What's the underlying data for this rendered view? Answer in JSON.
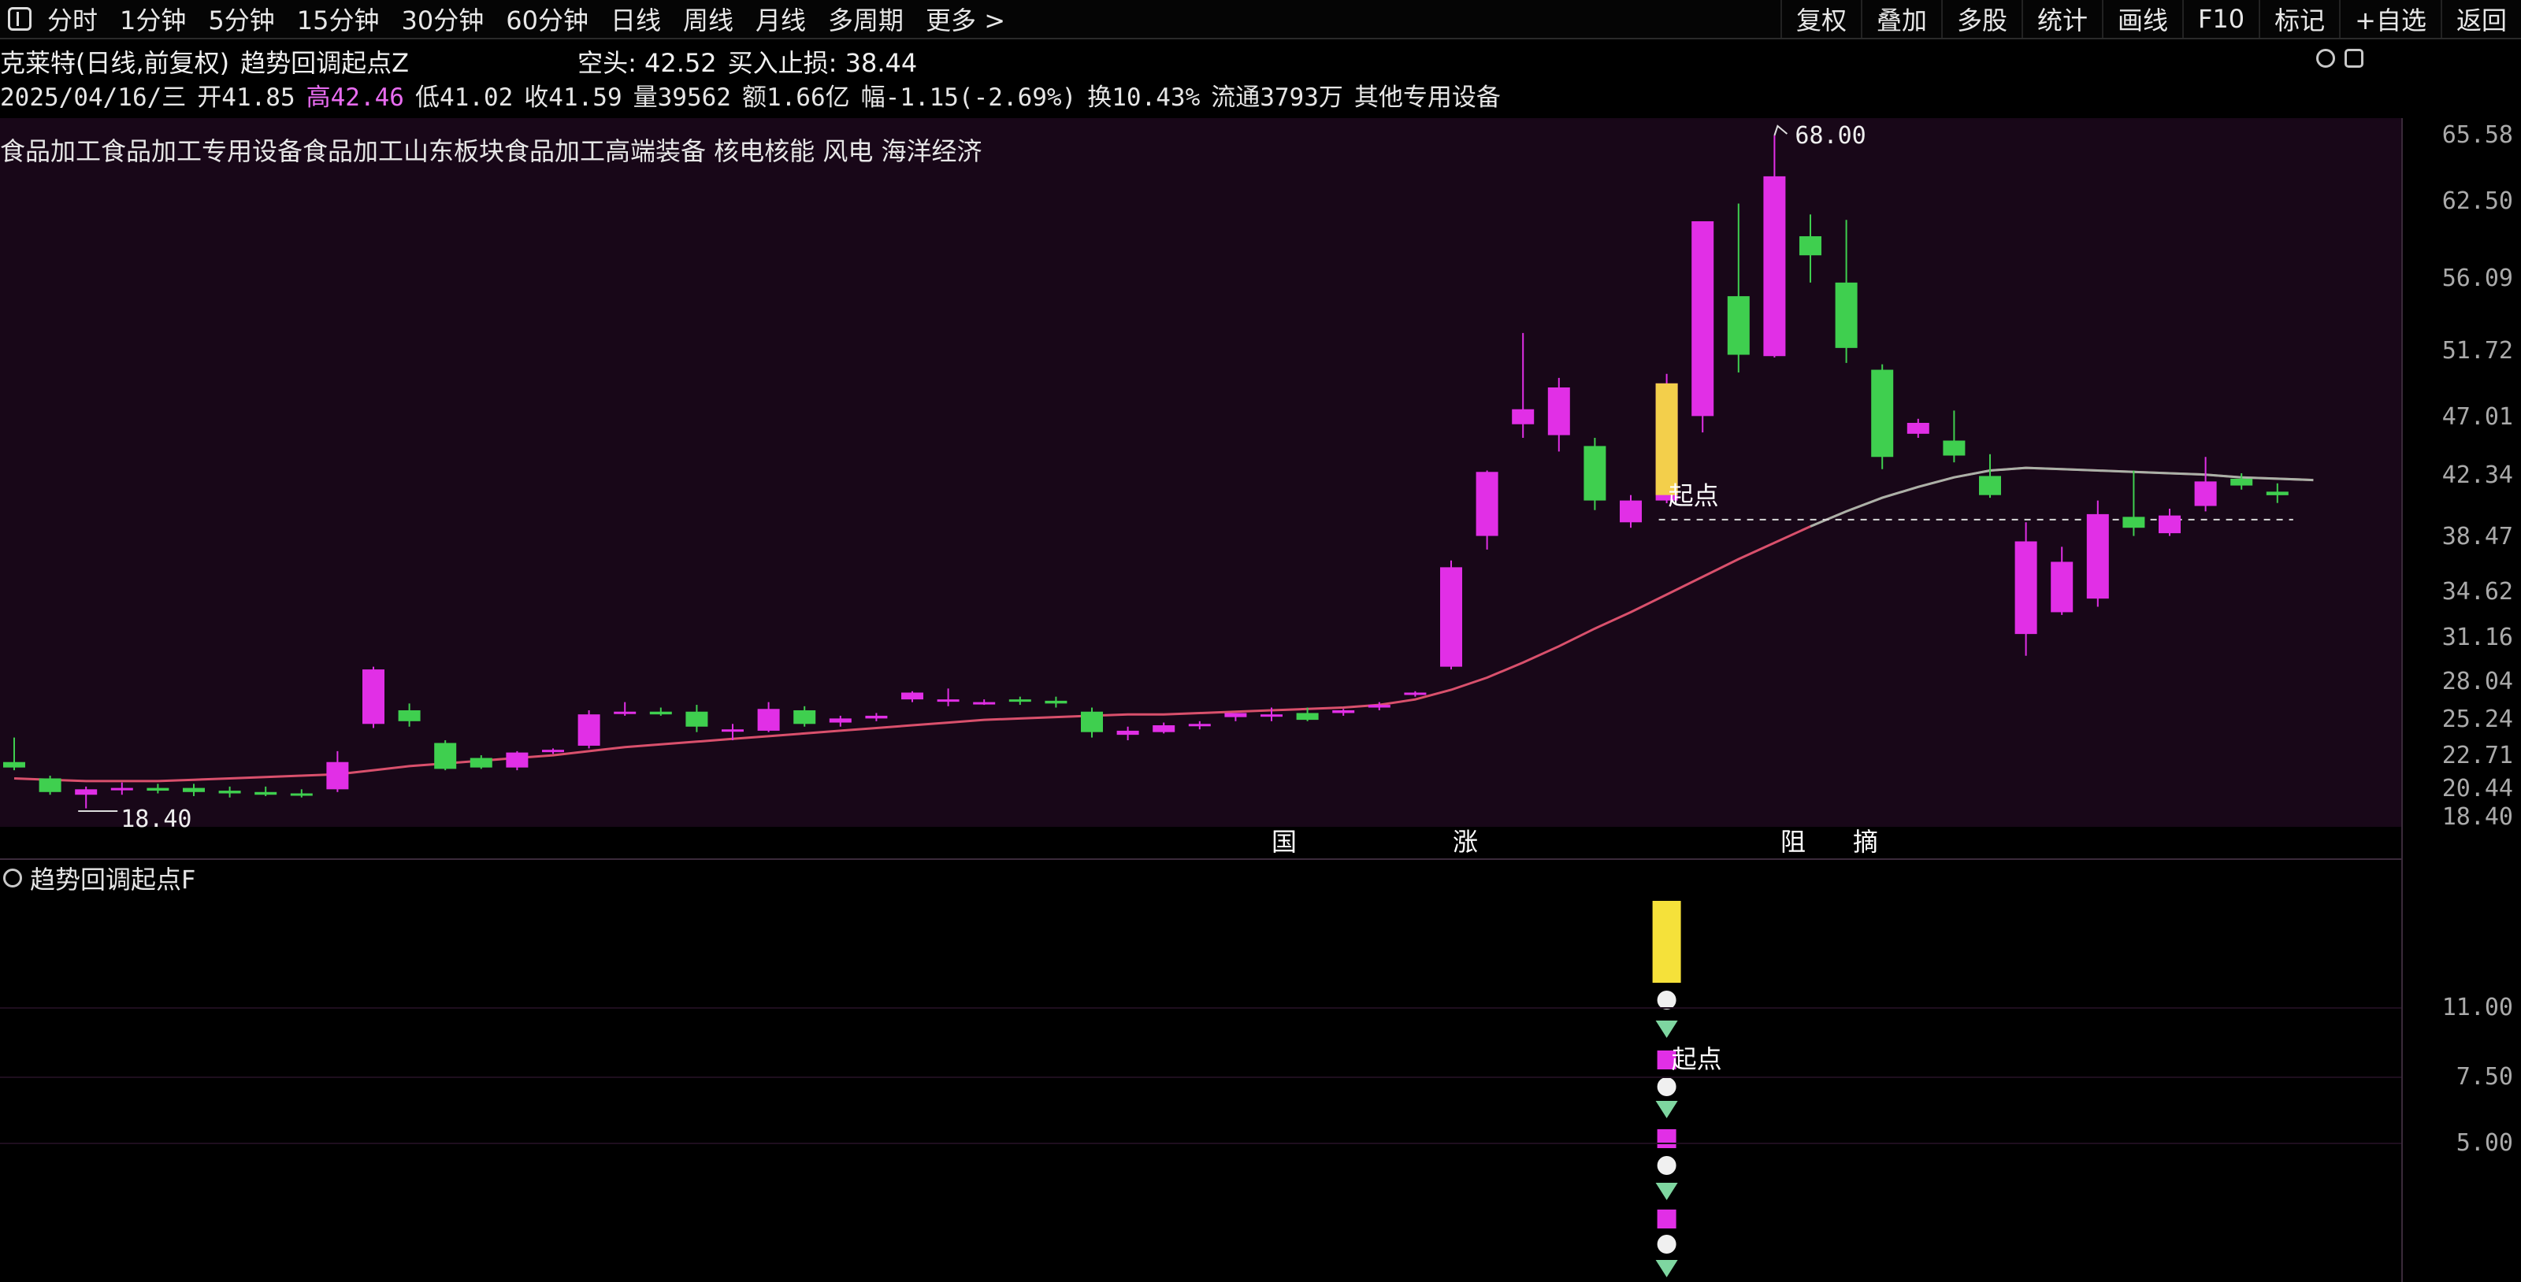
{
  "toolbar": {
    "left": [
      "分时",
      "1分钟",
      "5分钟",
      "15分钟",
      "30分钟",
      "60分钟",
      "日线",
      "周线",
      "月线",
      "多周期",
      "更多 >"
    ],
    "right": [
      "复权",
      "叠加",
      "多股",
      "统计",
      "画线",
      "F10",
      "标记",
      "+自选",
      "返回"
    ]
  },
  "info": {
    "stock": "克莱特(日线,前复权)",
    "indicator": "趋势回调起点Z",
    "short_label": "空头: 42.52",
    "stop_label": "买入止损: 38.44",
    "date": "2025/04/16/三",
    "open": "开41.85",
    "high": "高42.46",
    "low": "低41.02",
    "close": "收41.59",
    "volume": "量39562",
    "amount": "额1.66亿",
    "change": "幅-1.15(-2.69%)",
    "turnover": "换10.43%",
    "float": "流通3793万",
    "industry": "其他专用设备",
    "concepts": "食品加工食品加工专用设备食品加工山东板块食品加工高端装备 核电核能 风电 海洋经济"
  },
  "sub_title": "趋势回调起点F",
  "annotations": {
    "peak": "68.00",
    "low": "18.40",
    "start_point": "起点",
    "sub_start_point": "起点",
    "histogram_marks": [
      "国",
      "涨",
      "阻",
      "摘"
    ]
  },
  "axis": {
    "main": [
      "65.58",
      "62.50",
      "56.09",
      "51.72",
      "47.01",
      "42.34",
      "38.47",
      "34.62",
      "31.16",
      "28.04",
      "25.24",
      "22.71",
      "20.44",
      "18.40"
    ],
    "sub": [
      "11.00",
      "7.50",
      "5.00"
    ]
  },
  "colors": {
    "up": "#e12fe6",
    "down": "#3fcf4f",
    "ma": "#d9506c",
    "signal": "#f5e13a",
    "dashline": "#d8d8d8",
    "background_main": "#180718"
  },
  "chart_data": {
    "type": "candlestick",
    "candles": [
      {
        "o": 22.0,
        "h": 23.8,
        "l": 21.4,
        "c": 21.6
      },
      {
        "o": 20.8,
        "h": 21.0,
        "l": 19.6,
        "c": 19.8
      },
      {
        "o": 19.6,
        "h": 20.2,
        "l": 18.6,
        "c": 20.0
      },
      {
        "o": 20.0,
        "h": 20.5,
        "l": 19.6,
        "c": 20.1
      },
      {
        "o": 20.1,
        "h": 20.4,
        "l": 19.7,
        "c": 19.9
      },
      {
        "o": 20.1,
        "h": 20.4,
        "l": 19.5,
        "c": 19.8
      },
      {
        "o": 19.9,
        "h": 20.2,
        "l": 19.4,
        "c": 19.7
      },
      {
        "o": 19.8,
        "h": 20.2,
        "l": 19.5,
        "c": 19.6
      },
      {
        "o": 19.7,
        "h": 20.0,
        "l": 19.4,
        "c": 19.6
      },
      {
        "o": 20.0,
        "h": 22.8,
        "l": 19.8,
        "c": 22.0
      },
      {
        "o": 24.8,
        "h": 29.0,
        "l": 24.5,
        "c": 28.8
      },
      {
        "o": 25.8,
        "h": 26.3,
        "l": 24.6,
        "c": 25.0
      },
      {
        "o": 23.4,
        "h": 23.6,
        "l": 21.4,
        "c": 21.5
      },
      {
        "o": 22.3,
        "h": 22.5,
        "l": 21.5,
        "c": 21.6
      },
      {
        "o": 21.6,
        "h": 22.8,
        "l": 21.4,
        "c": 22.7
      },
      {
        "o": 22.8,
        "h": 23.0,
        "l": 22.6,
        "c": 22.9
      },
      {
        "o": 23.2,
        "h": 25.8,
        "l": 23.0,
        "c": 25.5
      },
      {
        "o": 25.6,
        "h": 26.4,
        "l": 25.4,
        "c": 25.7
      },
      {
        "o": 25.7,
        "h": 26.0,
        "l": 25.4,
        "c": 25.5
      },
      {
        "o": 25.7,
        "h": 26.2,
        "l": 24.2,
        "c": 24.6
      },
      {
        "o": 24.4,
        "h": 24.8,
        "l": 23.6,
        "c": 24.4
      },
      {
        "o": 24.3,
        "h": 26.4,
        "l": 24.2,
        "c": 25.9
      },
      {
        "o": 25.8,
        "h": 26.1,
        "l": 24.6,
        "c": 24.8
      },
      {
        "o": 24.9,
        "h": 25.4,
        "l": 24.6,
        "c": 25.2
      },
      {
        "o": 25.2,
        "h": 25.6,
        "l": 25.0,
        "c": 25.4
      },
      {
        "o": 26.6,
        "h": 27.2,
        "l": 26.4,
        "c": 27.1
      },
      {
        "o": 26.6,
        "h": 27.4,
        "l": 26.1,
        "c": 26.6
      },
      {
        "o": 26.4,
        "h": 26.6,
        "l": 26.2,
        "c": 26.4
      },
      {
        "o": 26.6,
        "h": 26.8,
        "l": 26.2,
        "c": 26.5
      },
      {
        "o": 26.5,
        "h": 26.8,
        "l": 26.0,
        "c": 26.3
      },
      {
        "o": 25.7,
        "h": 26.0,
        "l": 23.8,
        "c": 24.2
      },
      {
        "o": 24.0,
        "h": 24.6,
        "l": 23.6,
        "c": 24.3
      },
      {
        "o": 24.2,
        "h": 24.9,
        "l": 24.1,
        "c": 24.7
      },
      {
        "o": 24.7,
        "h": 25.0,
        "l": 24.4,
        "c": 24.8
      },
      {
        "o": 25.3,
        "h": 25.6,
        "l": 25.0,
        "c": 25.6
      },
      {
        "o": 25.4,
        "h": 26.0,
        "l": 25.0,
        "c": 25.5
      },
      {
        "o": 25.6,
        "h": 26.0,
        "l": 25.0,
        "c": 25.1
      },
      {
        "o": 25.6,
        "h": 25.9,
        "l": 25.4,
        "c": 25.8
      },
      {
        "o": 26.0,
        "h": 26.4,
        "l": 25.8,
        "c": 26.2
      },
      {
        "o": 27.0,
        "h": 27.2,
        "l": 26.8,
        "c": 27.1
      },
      {
        "o": 29.0,
        "h": 36.8,
        "l": 28.8,
        "c": 36.3
      },
      {
        "o": 38.6,
        "h": 43.4,
        "l": 37.6,
        "c": 43.3
      },
      {
        "o": 46.8,
        "h": 53.5,
        "l": 45.8,
        "c": 47.9
      },
      {
        "o": 46.0,
        "h": 50.2,
        "l": 44.8,
        "c": 49.5
      },
      {
        "o": 45.2,
        "h": 45.8,
        "l": 40.5,
        "c": 41.2
      },
      {
        "o": 39.6,
        "h": 41.6,
        "l": 39.2,
        "c": 41.2
      },
      {
        "o": 41.2,
        "h": 50.5,
        "l": 41.0,
        "c": 49.8
      },
      {
        "o": 47.4,
        "h": 61.7,
        "l": 46.2,
        "c": 61.7
      },
      {
        "o": 56.2,
        "h": 63.0,
        "l": 50.6,
        "c": 51.9
      },
      {
        "o": 51.8,
        "h": 68.0,
        "l": 51.7,
        "c": 65.0
      },
      {
        "o": 60.6,
        "h": 62.2,
        "l": 57.2,
        "c": 59.2
      },
      {
        "o": 57.2,
        "h": 61.8,
        "l": 51.3,
        "c": 52.4
      },
      {
        "o": 50.8,
        "h": 51.2,
        "l": 43.5,
        "c": 44.4
      },
      {
        "o": 46.1,
        "h": 47.2,
        "l": 45.8,
        "c": 46.9
      },
      {
        "o": 45.6,
        "h": 47.8,
        "l": 44.0,
        "c": 44.5
      },
      {
        "o": 43.0,
        "h": 44.6,
        "l": 41.4,
        "c": 41.6
      },
      {
        "o": 31.4,
        "h": 39.6,
        "l": 29.8,
        "c": 38.2
      },
      {
        "o": 33.0,
        "h": 37.8,
        "l": 32.8,
        "c": 36.7
      },
      {
        "o": 34.0,
        "h": 41.2,
        "l": 33.4,
        "c": 40.2
      },
      {
        "o": 40.0,
        "h": 43.4,
        "l": 38.6,
        "c": 39.2
      },
      {
        "o": 38.8,
        "h": 40.6,
        "l": 38.6,
        "c": 40.1
      },
      {
        "o": 40.8,
        "h": 44.4,
        "l": 40.4,
        "c": 42.6
      },
      {
        "o": 42.8,
        "h": 43.2,
        "l": 42.0,
        "c": 42.3
      },
      {
        "o": 41.85,
        "h": 42.46,
        "l": 41.02,
        "c": 41.59
      }
    ],
    "signal_bar": {
      "open": 41.6,
      "close": 49.8,
      "index": 46
    },
    "dashline_value": 39.8,
    "ma": [
      20.8,
      20.7,
      20.6,
      20.6,
      20.6,
      20.7,
      20.8,
      20.9,
      21.0,
      21.1,
      21.4,
      21.7,
      21.9,
      22.1,
      22.3,
      22.5,
      22.8,
      23.1,
      23.3,
      23.5,
      23.7,
      23.9,
      24.1,
      24.3,
      24.5,
      24.7,
      24.9,
      25.1,
      25.2,
      25.3,
      25.4,
      25.5,
      25.5,
      25.6,
      25.7,
      25.8,
      25.9,
      26.0,
      26.2,
      26.6,
      27.3,
      28.2,
      29.3,
      30.5,
      31.8,
      33.0,
      34.3,
      35.6,
      36.9,
      38.1,
      39.3,
      40.4,
      41.4,
      42.2,
      42.9,
      43.4,
      43.6,
      43.5,
      43.4,
      43.3,
      43.2,
      43.1,
      42.9,
      42.8,
      42.7
    ],
    "sub_signal": {
      "top": 14.5,
      "bottom": 11.8,
      "index": 46
    }
  }
}
